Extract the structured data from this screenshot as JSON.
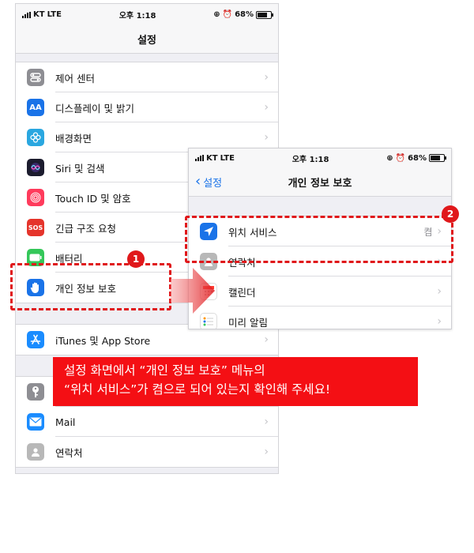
{
  "colors": {
    "accent_red": "#e0181b",
    "callout_red": "#f40f14",
    "ios_blue": "#1a73e8"
  },
  "settings_screen": {
    "status": {
      "carrier": "KT",
      "network": "LTE",
      "time": "오후 1:18",
      "battery": "68%"
    },
    "title": "설정",
    "rows": [
      {
        "label": "제어 센터",
        "icon": "control-center-icon",
        "color": "#8e8e93"
      },
      {
        "label": "디스플레이 및 밝기",
        "icon": "display-brightness-icon",
        "icon_text": "AA",
        "color": "#1a73e8"
      },
      {
        "label": "배경화면",
        "icon": "wallpaper-icon",
        "color": "#2aa7e0"
      },
      {
        "label": "Siri 및 검색",
        "icon": "siri-icon",
        "color": "#1c1c2e"
      },
      {
        "label": "Touch ID 및 암호",
        "icon": "fingerprint-icon",
        "color": "#ff3b5c"
      },
      {
        "label": "긴급 구조 요청",
        "icon": "sos-icon",
        "icon_text": "SOS",
        "color": "#e5342b"
      },
      {
        "label": "배터리",
        "icon": "battery-icon",
        "color": "#34c759"
      },
      {
        "label": "개인 정보 보호",
        "icon": "hand-privacy-icon",
        "color": "#1a73e8"
      },
      {
        "label": "iTunes 및 App Store",
        "icon": "app-store-icon",
        "color": "#1a8cff"
      },
      {
        "label": "",
        "icon": "key-icon",
        "color": "#8e8e93"
      },
      {
        "label": "Mail",
        "icon": "mail-icon",
        "color": "#1a8cff"
      },
      {
        "label": "연락처",
        "icon": "contacts-icon",
        "color": "#b8b8b8"
      }
    ]
  },
  "privacy_screen": {
    "status": {
      "carrier": "KT",
      "network": "LTE",
      "time": "오후 1:18",
      "battery": "68%"
    },
    "back_label": "설정",
    "title": "개인 정보 보호",
    "rows": [
      {
        "label": "위치 서비스",
        "value": "켬",
        "icon": "location-arrow-icon",
        "color": "#1a73e8"
      },
      {
        "label": "연락처",
        "value": "",
        "icon": "contacts-icon",
        "color": "#b8b8b8"
      },
      {
        "label": "캘린더",
        "value": "",
        "icon": "calendar-icon",
        "color": "#ffffff"
      },
      {
        "label": "미리 알림",
        "value": "",
        "icon": "reminders-icon",
        "color": "#ffffff"
      }
    ]
  },
  "annotations": {
    "badge_1": "1",
    "badge_2": "2",
    "callout_line1": "설정 화면에서 “개인 정보 보호” 메뉴의",
    "callout_line2": "“위치 서비스”가 켬으로 되어 있는지 확인해 주세요!"
  }
}
